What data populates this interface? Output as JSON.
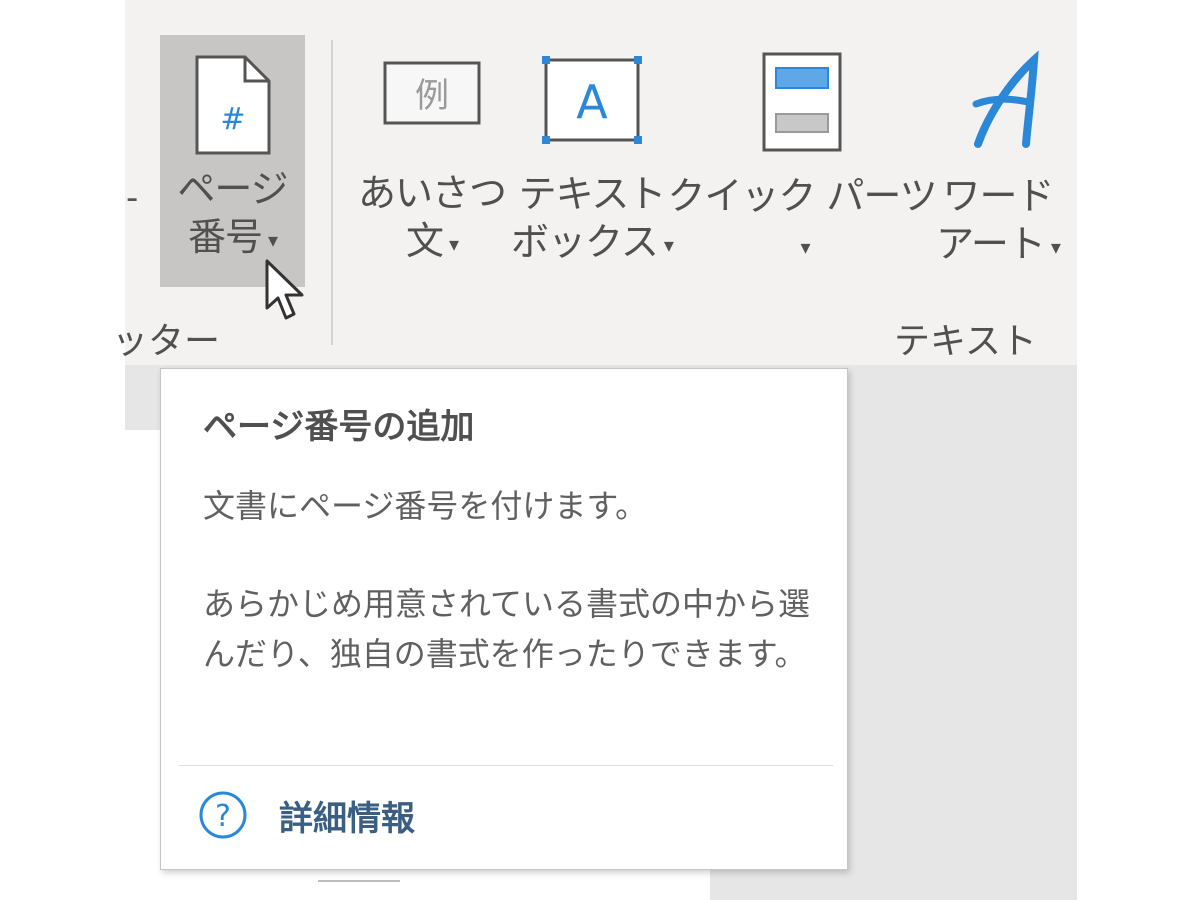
{
  "ribbon": {
    "left_edge": {
      "separator_glyph": "-",
      "group_label": "ッター"
    },
    "page_number_button": {
      "line1": "ページ",
      "line2": "番号",
      "caret": "▾",
      "icon_glyph": "#"
    },
    "greeting_button": {
      "line1": "あいさつ",
      "line2": "文",
      "caret": "▾",
      "icon_glyph": "例"
    },
    "textbox_button": {
      "line1": "テキスト",
      "line2": "ボックス",
      "caret": "▾",
      "icon_glyph": "A"
    },
    "quickparts_button": {
      "line1": "クイック パーツ",
      "caret": "▾"
    },
    "wordart_button": {
      "line1": "ワード",
      "line2": "アート",
      "caret": "▾"
    },
    "text_group_label": "テキスト"
  },
  "tooltip": {
    "title": "ページ番号の追加",
    "description": "文書にページ番号を付けます。",
    "detail": "あらかじめ用意されている書式の中から選んだり、独自の書式を作ったりできます。",
    "link_icon_glyph": "?",
    "link_label": "詳細情報"
  },
  "colors": {
    "ribbon_bg": "#f3f2f1",
    "hover_bg": "#c8c6c4",
    "accent_blue": "#2b88d8",
    "link_text": "#3a5f82"
  }
}
